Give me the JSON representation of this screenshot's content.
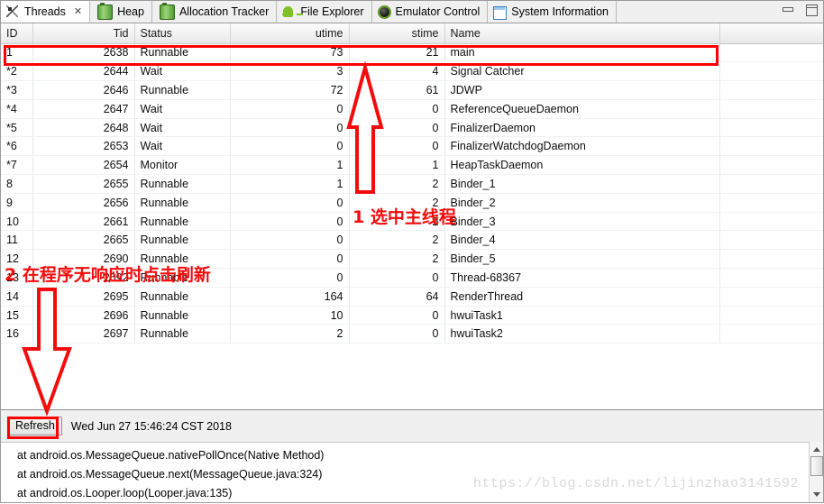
{
  "window": {
    "minimize_label": "minimize",
    "restore_label": "restore"
  },
  "tabs": [
    {
      "label": "Threads",
      "icon": "threads-icon",
      "active": true,
      "closeable": true
    },
    {
      "label": "Heap",
      "icon": "heap-icon",
      "active": false,
      "closeable": false
    },
    {
      "label": "Allocation Tracker",
      "icon": "heap-icon",
      "active": false,
      "closeable": false
    },
    {
      "label": "File Explorer",
      "icon": "android-icon",
      "active": false,
      "closeable": false
    },
    {
      "label": "Emulator Control",
      "icon": "emulator-icon",
      "active": false,
      "closeable": false
    },
    {
      "label": "System Information",
      "icon": "window-icon",
      "active": false,
      "closeable": false
    }
  ],
  "close_glyph": "✕",
  "table": {
    "columns": [
      "ID",
      "Tid",
      "Status",
      "utime",
      "stime",
      "Name"
    ],
    "rows": [
      {
        "id": "1",
        "tid": "2638",
        "status": "Runnable",
        "utime": "73",
        "stime": "21",
        "name": "main"
      },
      {
        "id": "*2",
        "tid": "2644",
        "status": "Wait",
        "utime": "3",
        "stime": "4",
        "name": "Signal Catcher"
      },
      {
        "id": "*3",
        "tid": "2646",
        "status": "Runnable",
        "utime": "72",
        "stime": "61",
        "name": "JDWP"
      },
      {
        "id": "*4",
        "tid": "2647",
        "status": "Wait",
        "utime": "0",
        "stime": "0",
        "name": "ReferenceQueueDaemon"
      },
      {
        "id": "*5",
        "tid": "2648",
        "status": "Wait",
        "utime": "0",
        "stime": "0",
        "name": "FinalizerDaemon"
      },
      {
        "id": "*6",
        "tid": "2653",
        "status": "Wait",
        "utime": "0",
        "stime": "0",
        "name": "FinalizerWatchdogDaemon"
      },
      {
        "id": "*7",
        "tid": "2654",
        "status": "Monitor",
        "utime": "1",
        "stime": "1",
        "name": "HeapTaskDaemon"
      },
      {
        "id": "8",
        "tid": "2655",
        "status": "Runnable",
        "utime": "1",
        "stime": "2",
        "name": "Binder_1"
      },
      {
        "id": "9",
        "tid": "2656",
        "status": "Runnable",
        "utime": "0",
        "stime": "2",
        "name": "Binder_2"
      },
      {
        "id": "10",
        "tid": "2661",
        "status": "Runnable",
        "utime": "0",
        "stime": "2",
        "name": "Binder_3"
      },
      {
        "id": "11",
        "tid": "2665",
        "status": "Runnable",
        "utime": "0",
        "stime": "2",
        "name": "Binder_4"
      },
      {
        "id": "12",
        "tid": "2690",
        "status": "Runnable",
        "utime": "0",
        "stime": "2",
        "name": "Binder_5"
      },
      {
        "id": "13",
        "tid": "2692",
        "status": "Runnable",
        "utime": "0",
        "stime": "0",
        "name": "Thread-68367"
      },
      {
        "id": "14",
        "tid": "2695",
        "status": "Runnable",
        "utime": "164",
        "stime": "64",
        "name": "RenderThread"
      },
      {
        "id": "15",
        "tid": "2696",
        "status": "Runnable",
        "utime": "10",
        "stime": "0",
        "name": "hwuiTask1"
      },
      {
        "id": "16",
        "tid": "2697",
        "status": "Runnable",
        "utime": "2",
        "stime": "0",
        "name": "hwuiTask2"
      }
    ]
  },
  "bottom": {
    "refresh_label": "Refresh",
    "timestamp": "Wed Jun 27 15:46:24 CST 2018",
    "stack_lines": [
      "at android.os.MessageQueue.nativePollOnce(Native Method)",
      "at android.os.MessageQueue.next(MessageQueue.java:324)",
      "at android.os.Looper.loop(Looper.java:135)"
    ]
  },
  "annotations": {
    "note_1": "1 选中主线程",
    "note_2": "2 在程序无响应时点击刷新",
    "highlight_color": "#ff0000",
    "text_color": "#f40b0b"
  },
  "watermark": "https://blog.csdn.net/lijinzhao3141592"
}
